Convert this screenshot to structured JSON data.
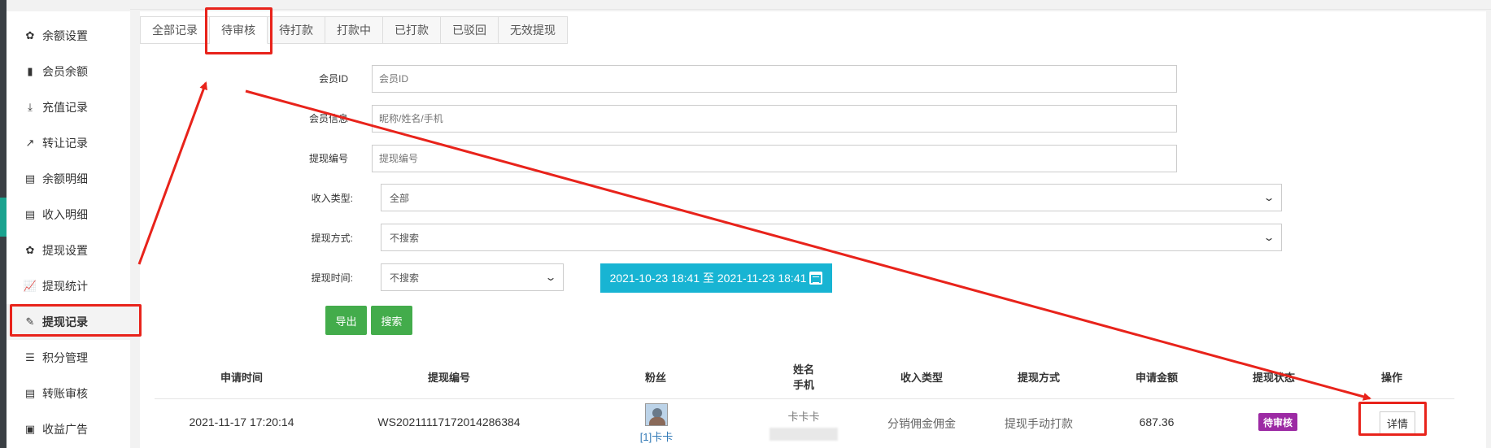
{
  "sidebar": {
    "items": [
      {
        "label": "余额设置",
        "icon": "gear-icon"
      },
      {
        "label": "会员余额",
        "icon": "book-icon"
      },
      {
        "label": "充值记录",
        "icon": "download-icon"
      },
      {
        "label": "转让记录",
        "icon": "external-link-icon"
      },
      {
        "label": "余额明细",
        "icon": "document-icon"
      },
      {
        "label": "收入明细",
        "icon": "document-icon"
      },
      {
        "label": "提现设置",
        "icon": "gear-icon"
      },
      {
        "label": "提现统计",
        "icon": "line-chart-icon"
      },
      {
        "label": "提现记录",
        "icon": "pencil-icon"
      },
      {
        "label": "积分管理",
        "icon": "database-icon"
      },
      {
        "label": "转账审核",
        "icon": "document-icon"
      },
      {
        "label": "收益广告",
        "icon": "image-icon"
      }
    ],
    "active_label": "提现记录"
  },
  "tabs": [
    "全部记录",
    "待审核",
    "待打款",
    "打款中",
    "已打款",
    "已驳回",
    "无效提现"
  ],
  "active_tab": "待审核",
  "filters": {
    "member_id": {
      "label": "会员ID",
      "placeholder": "会员ID"
    },
    "member_info": {
      "label": "会员信息",
      "placeholder": "昵称/姓名/手机"
    },
    "withdraw_no": {
      "label": "提现编号",
      "placeholder": "提现编号"
    },
    "income_type": {
      "label": "收入类型:",
      "value": "全部"
    },
    "withdraw_method": {
      "label": "提现方式:",
      "value": "不搜索"
    },
    "withdraw_time": {
      "label": "提现时间:",
      "value": "不搜索"
    },
    "date_range": "2021-10-23 18:41 至 2021-11-23 18:41"
  },
  "buttons": {
    "export": "导出",
    "search": "搜索"
  },
  "table": {
    "headers": [
      "申请时间",
      "提现编号",
      "粉丝",
      "姓名",
      "手机",
      "收入类型",
      "提现方式",
      "申请金额",
      "提现状态",
      "操作"
    ],
    "rows": [
      {
        "time": "2021-11-17 17:20:14",
        "no": "WS20211117172014286384",
        "fan": "[1]卡卡",
        "name": "卡卡卡",
        "type": "分销佣金佣金",
        "method": "提现手动打款",
        "amount": "687.36",
        "status": "待审核",
        "action": "详情"
      }
    ]
  },
  "colors": {
    "highlight": "#e8231b",
    "status_badge": "#9c2aa4",
    "primary_button": "#43ac4b",
    "date_button": "#18b4d3"
  }
}
